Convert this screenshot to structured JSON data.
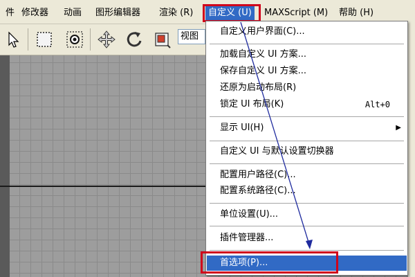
{
  "menubar": {
    "items": [
      {
        "label": "件"
      },
      {
        "label": "修改器"
      },
      {
        "label": "动画"
      },
      {
        "label": "图形编辑器"
      },
      {
        "label": "渲染 (R)"
      },
      {
        "label": "自定义 (U)"
      },
      {
        "label": "MAXScript (M)"
      },
      {
        "label": "帮助 (H)"
      }
    ],
    "active_index": 5
  },
  "toolbar": {
    "view_label": "视图"
  },
  "dropdown": {
    "items": [
      {
        "label": "自定义用户界面(C)..."
      },
      {
        "label": "加载自定义 UI 方案..."
      },
      {
        "label": "保存自定义 UI 方案..."
      },
      {
        "label": "还原为启动布局(R)"
      },
      {
        "label": "锁定 UI 布局(K)",
        "shortcut": "Alt+0"
      },
      {
        "label": "显示 UI(H)"
      },
      {
        "label": "自定义 UI 与默认设置切换器"
      },
      {
        "label": "配置用户路径(C)..."
      },
      {
        "label": "配置系统路径(C)..."
      },
      {
        "label": "单位设置(U)..."
      },
      {
        "label": "插件管理器..."
      },
      {
        "label": "首选项(P)..."
      }
    ],
    "selected_index": 11,
    "submenu_arrow": "▶"
  },
  "colors": {
    "highlight_blue": "#316ac5",
    "annotation_red": "#d0021b",
    "annotation_arrow": "#1f2b9e"
  },
  "icons": [
    "cursor-arrow-icon",
    "rect-select-icon",
    "circle-select-icon",
    "move-icon",
    "rotate-icon",
    "scale-icon"
  ]
}
